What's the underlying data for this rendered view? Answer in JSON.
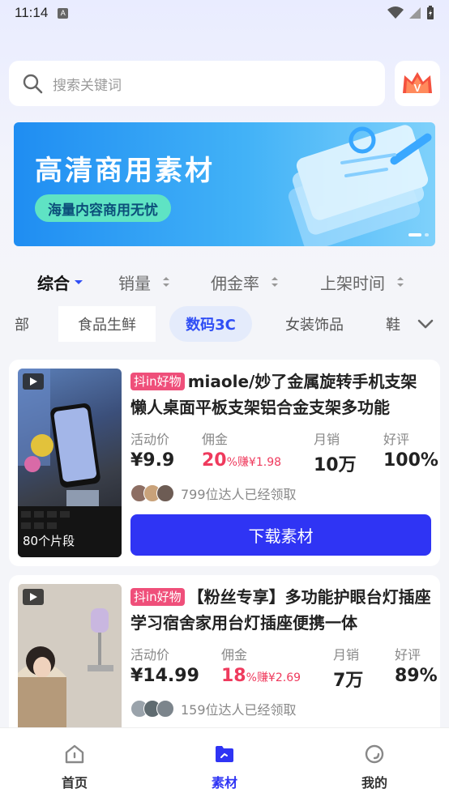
{
  "status_bar": {
    "time": "11:14",
    "notification": "A"
  },
  "search": {
    "placeholder": "搜索关键词"
  },
  "vip": {
    "letter": "V"
  },
  "banner": {
    "title": "高清商用素材",
    "subtitle": "海量内容商用无忧"
  },
  "sort_tabs": [
    {
      "label": "综合",
      "active": true
    },
    {
      "label": "销量"
    },
    {
      "label": "佣金率"
    },
    {
      "label": "上架时间"
    }
  ],
  "categories": [
    {
      "label": "部"
    },
    {
      "label": "食品生鲜"
    },
    {
      "label": "数码3C",
      "active": true
    },
    {
      "label": "女装饰品"
    },
    {
      "label": "鞋"
    }
  ],
  "stat_labels": {
    "price": "活动价",
    "commission": "佣金",
    "monthly_sales": "月销",
    "rating": "好评"
  },
  "products": [
    {
      "tag": "抖in好物",
      "title": "miaole/妙了金属旋转手机支架懒人桌面平板支架铝合金支架多功能",
      "price": "¥9.9",
      "commission_rate": "20",
      "commission_pct_sign": "%",
      "commission_earn": "赚¥1.98",
      "monthly_sales": "10万",
      "rating": "100%",
      "takers": "799位达人已经领取",
      "clip_count": "80个片段",
      "download_label": "下载素材"
    },
    {
      "tag": "抖in好物",
      "title": "【粉丝专享】多功能护眼台灯插座学习宿舍家用台灯插座便携一体",
      "price": "¥14.99",
      "commission_rate": "18",
      "commission_pct_sign": "%",
      "commission_earn": "赚¥2.69",
      "monthly_sales": "7万",
      "rating": "89%",
      "takers": "159位达人已经领取"
    }
  ],
  "tab_bar": [
    {
      "label": "首页",
      "icon": "home-icon"
    },
    {
      "label": "素材",
      "icon": "folder-icon",
      "active": true
    },
    {
      "label": "我的",
      "icon": "profile-icon"
    }
  ],
  "colors": {
    "accent": "#2f34f4",
    "commission": "#ef3a5d",
    "tag": "#ef4f7a",
    "banner_pill": "#5fe3c4"
  }
}
